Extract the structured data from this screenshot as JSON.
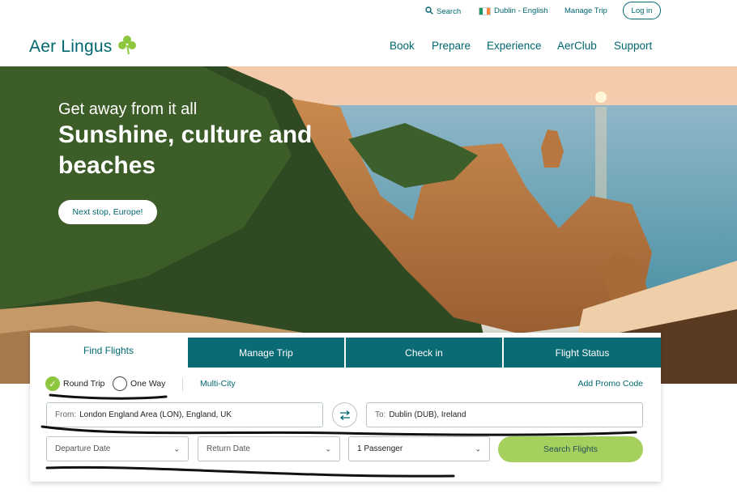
{
  "utility": {
    "search": "Search",
    "language": "Dublin - English",
    "manage_trip": "Manage Trip",
    "login": "Log in"
  },
  "brand": {
    "name": "Aer Lingus"
  },
  "nav": [
    "Book",
    "Prepare",
    "Experience",
    "AerClub",
    "Support"
  ],
  "hero": {
    "subtitle": "Get away from it all",
    "title": "Sunshine, culture and beaches",
    "cta": "Next stop, Europe!"
  },
  "booking": {
    "tabs": [
      "Find Flights",
      "Manage Trip",
      "Check in",
      "Flight Status"
    ],
    "active_tab": "Find Flights",
    "trip_types": {
      "round_trip": "Round Trip",
      "one_way": "One Way",
      "multi_city": "Multi-City",
      "selected": "Round Trip"
    },
    "promo": "Add Promo Code",
    "from": {
      "label": "From:",
      "value": "London England Area (LON), England, UK"
    },
    "to": {
      "label": "To:",
      "value": "Dublin (DUB), Ireland"
    },
    "departure": "Departure Date",
    "return": "Return Date",
    "passengers": "1 Passenger",
    "search_button": "Search Flights"
  },
  "colors": {
    "brand_teal": "#00676f",
    "tab_teal": "#0b6b74",
    "accent_green": "#a6d05d",
    "shamrock_green": "#8dc63f"
  },
  "icons": [
    "search-icon",
    "ireland-flag-icon",
    "shamrock-icon",
    "swap-icon",
    "chevron-down-icon",
    "check-icon"
  ]
}
